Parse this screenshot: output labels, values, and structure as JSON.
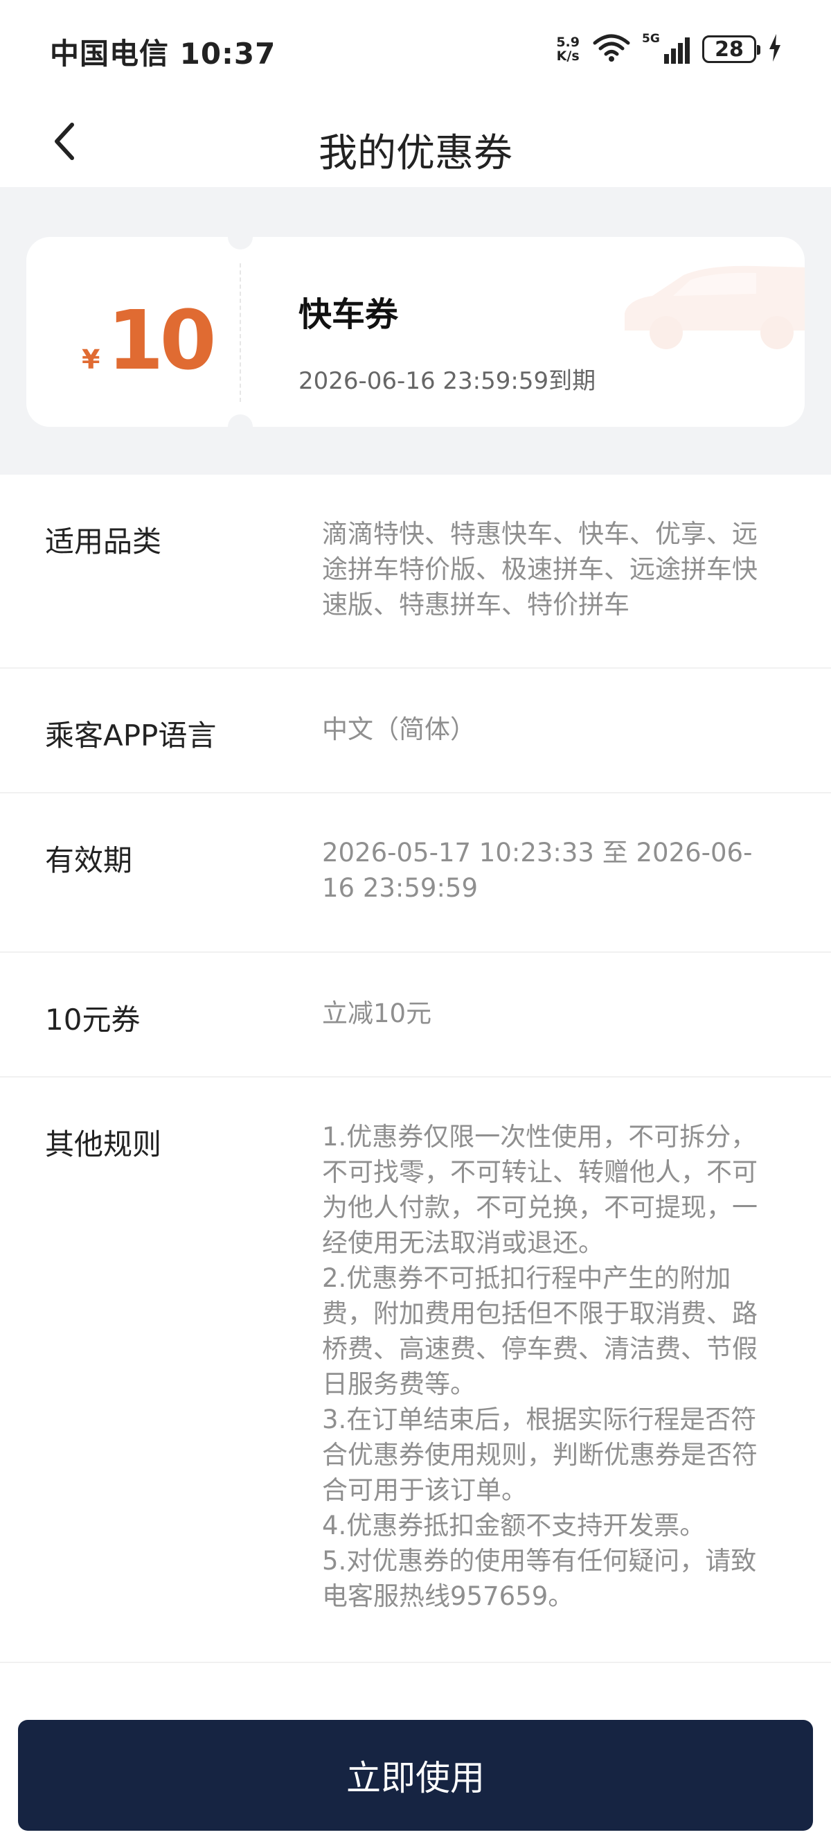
{
  "status_bar": {
    "carrier_time": "中国电信 10:37",
    "net_speed_value": "5.9",
    "net_speed_unit": "K/s",
    "network": "5G",
    "battery": "28"
  },
  "header": {
    "title": "我的优惠券"
  },
  "coupon": {
    "currency": "¥",
    "amount": "10",
    "name": "快车券",
    "expire": "2026-06-16 23:59:59到期",
    "accent_color": "#e06b32"
  },
  "details": {
    "category": {
      "label": "适用品类",
      "value": "滴滴特快、特惠快车、快车、优享、远途拼车特价版、极速拼车、远途拼车快速版、特惠拼车、特价拼车"
    },
    "language": {
      "label": "乘客APP语言",
      "value": "中文（简体）"
    },
    "validity": {
      "label": "有效期",
      "value": "2026-05-17 10:23:33 至 2026-06-16 23:59:59"
    },
    "coupon_type": {
      "label": "10元券",
      "value": "立减10元"
    },
    "rules": {
      "label": "其他规则",
      "lines": [
        "1.优惠券仅限一次性使用，不可拆分，不可找零，不可转让、转赠他人，不可为他人付款，不可兑换，不可提现，一经使用无法取消或退还。",
        "2.优惠券不可抵扣行程中产生的附加费，附加费用包括但不限于取消费、路桥费、高速费、停车费、清洁费、节假日服务费等。",
        "3.在订单结束后，根据实际行程是否符合优惠券使用规则，判断优惠券是否符合可用于该订单。",
        "4.优惠券抵扣金额不支持开发票。",
        "5.对优惠券的使用等有任何疑问，请致电客服热线957659。"
      ]
    }
  },
  "actions": {
    "use_label": "立即使用",
    "button_color": "#162442"
  }
}
